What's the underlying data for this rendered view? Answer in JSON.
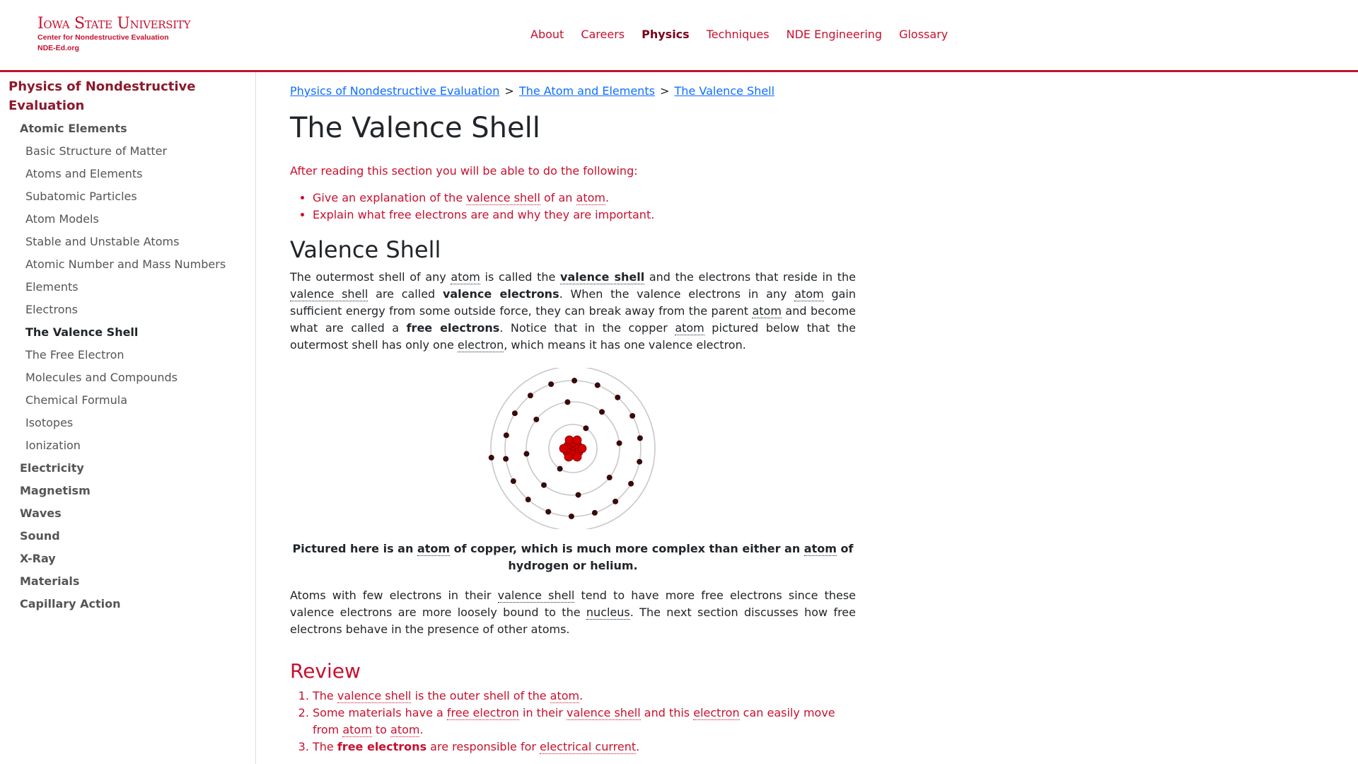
{
  "header": {
    "logo_line1": "Iowa State University",
    "logo_line2": "Center for Nondestructive Evaluation",
    "logo_line3": "NDE-Ed.org",
    "nav": [
      "About",
      "Careers",
      "Physics",
      "Techniques",
      "NDE Engineering",
      "Glossary"
    ],
    "active_nav": "Physics",
    "accent_color": "#c8102e"
  },
  "sidebar": {
    "title": "Physics of Nondestructive Evaluation",
    "sections": [
      {
        "label": "Atomic Elements",
        "items": [
          "Basic Structure of Matter",
          "Atoms and Elements",
          "Subatomic Particles",
          "Atom Models",
          "Stable and Unstable Atoms",
          "Atomic Number and Mass Numbers",
          "Elements",
          "Electrons",
          "The Valence Shell",
          "The Free Electron",
          "Molecules and Compounds",
          "Chemical Formula",
          "Isotopes",
          "Ionization"
        ]
      },
      {
        "label": "Electricity"
      },
      {
        "label": "Magnetism"
      },
      {
        "label": "Waves"
      },
      {
        "label": "Sound"
      },
      {
        "label": "X-Ray"
      },
      {
        "label": "Materials"
      },
      {
        "label": "Capillary Action"
      }
    ],
    "current": "The Valence Shell"
  },
  "breadcrumb": [
    "Physics of Nondestructive Evaluation",
    "The Atom and Elements",
    "The Valence Shell"
  ],
  "breadcrumb_sep": ">",
  "page_title": "The Valence Shell",
  "objectives": {
    "intro": "After reading this section you will be able to do the following:",
    "item1": {
      "t1": "Give an explanation of the ",
      "g1": "valence shell",
      "t2": " of an ",
      "g2": "atom",
      "t3": "."
    },
    "item2": "Explain what free electrons are and why they are important."
  },
  "section_heading": "Valence Shell",
  "para1": {
    "t1": "The outermost shell of any ",
    "g1": "atom",
    "t2": " is called the ",
    "b1": "valence shell",
    "t3": " and the electrons that reside in the ",
    "g2": "valence shell",
    "t4": " are called ",
    "b2": "valence electrons",
    "t5": ". When the valence electrons in any ",
    "g3": "atom",
    "t6": " gain sufficient energy from some outside force, they can break away from the parent ",
    "g4": "atom",
    "t7": " and become what are called a ",
    "b3": "free electrons",
    "t8": ". Notice that in the copper ",
    "g5": "atom",
    "t9": " pictured below that the outermost shell has only one ",
    "g6": "electron",
    "t10": ", which means it has one valence electron."
  },
  "atom_image": {
    "nucleus_color": "#d40000",
    "electron_color": "#3a0a0a",
    "shell_color": "#c8c8c8",
    "shells": [
      2,
      8,
      18,
      1
    ]
  },
  "caption": {
    "t1": "Pictured here is an ",
    "g1": "atom",
    "t2": " of copper, which is much more complex than either an ",
    "g2": "atom",
    "t3": " of hydrogen or helium."
  },
  "para2": {
    "t1": "Atoms with few electrons in their ",
    "g1": "valence shell",
    "t2": " tend to have more free electrons since these valence electrons are more loosely bound to the ",
    "g2": "nucleus",
    "t3": ". The next section discusses how free electrons behave in the presence of other atoms."
  },
  "review_heading": "Review",
  "review": {
    "i1": {
      "t1": "The ",
      "g1": "valence shell",
      "t2": " is the outer shell of the ",
      "g2": "atom",
      "t3": "."
    },
    "i2": {
      "t1": "Some materials have a ",
      "g1": "free electron",
      "t2": " in their ",
      "g2": "valence shell",
      "t3": " and this ",
      "g3": "electron",
      "t4": " can easily move from ",
      "g4": "atom",
      "t5": " to ",
      "g5": "atom",
      "t6": "."
    },
    "i3": {
      "t1": "The ",
      "b1": "free electrons",
      "t2": " are responsible for ",
      "g1": "electrical current",
      "t3": "."
    }
  }
}
